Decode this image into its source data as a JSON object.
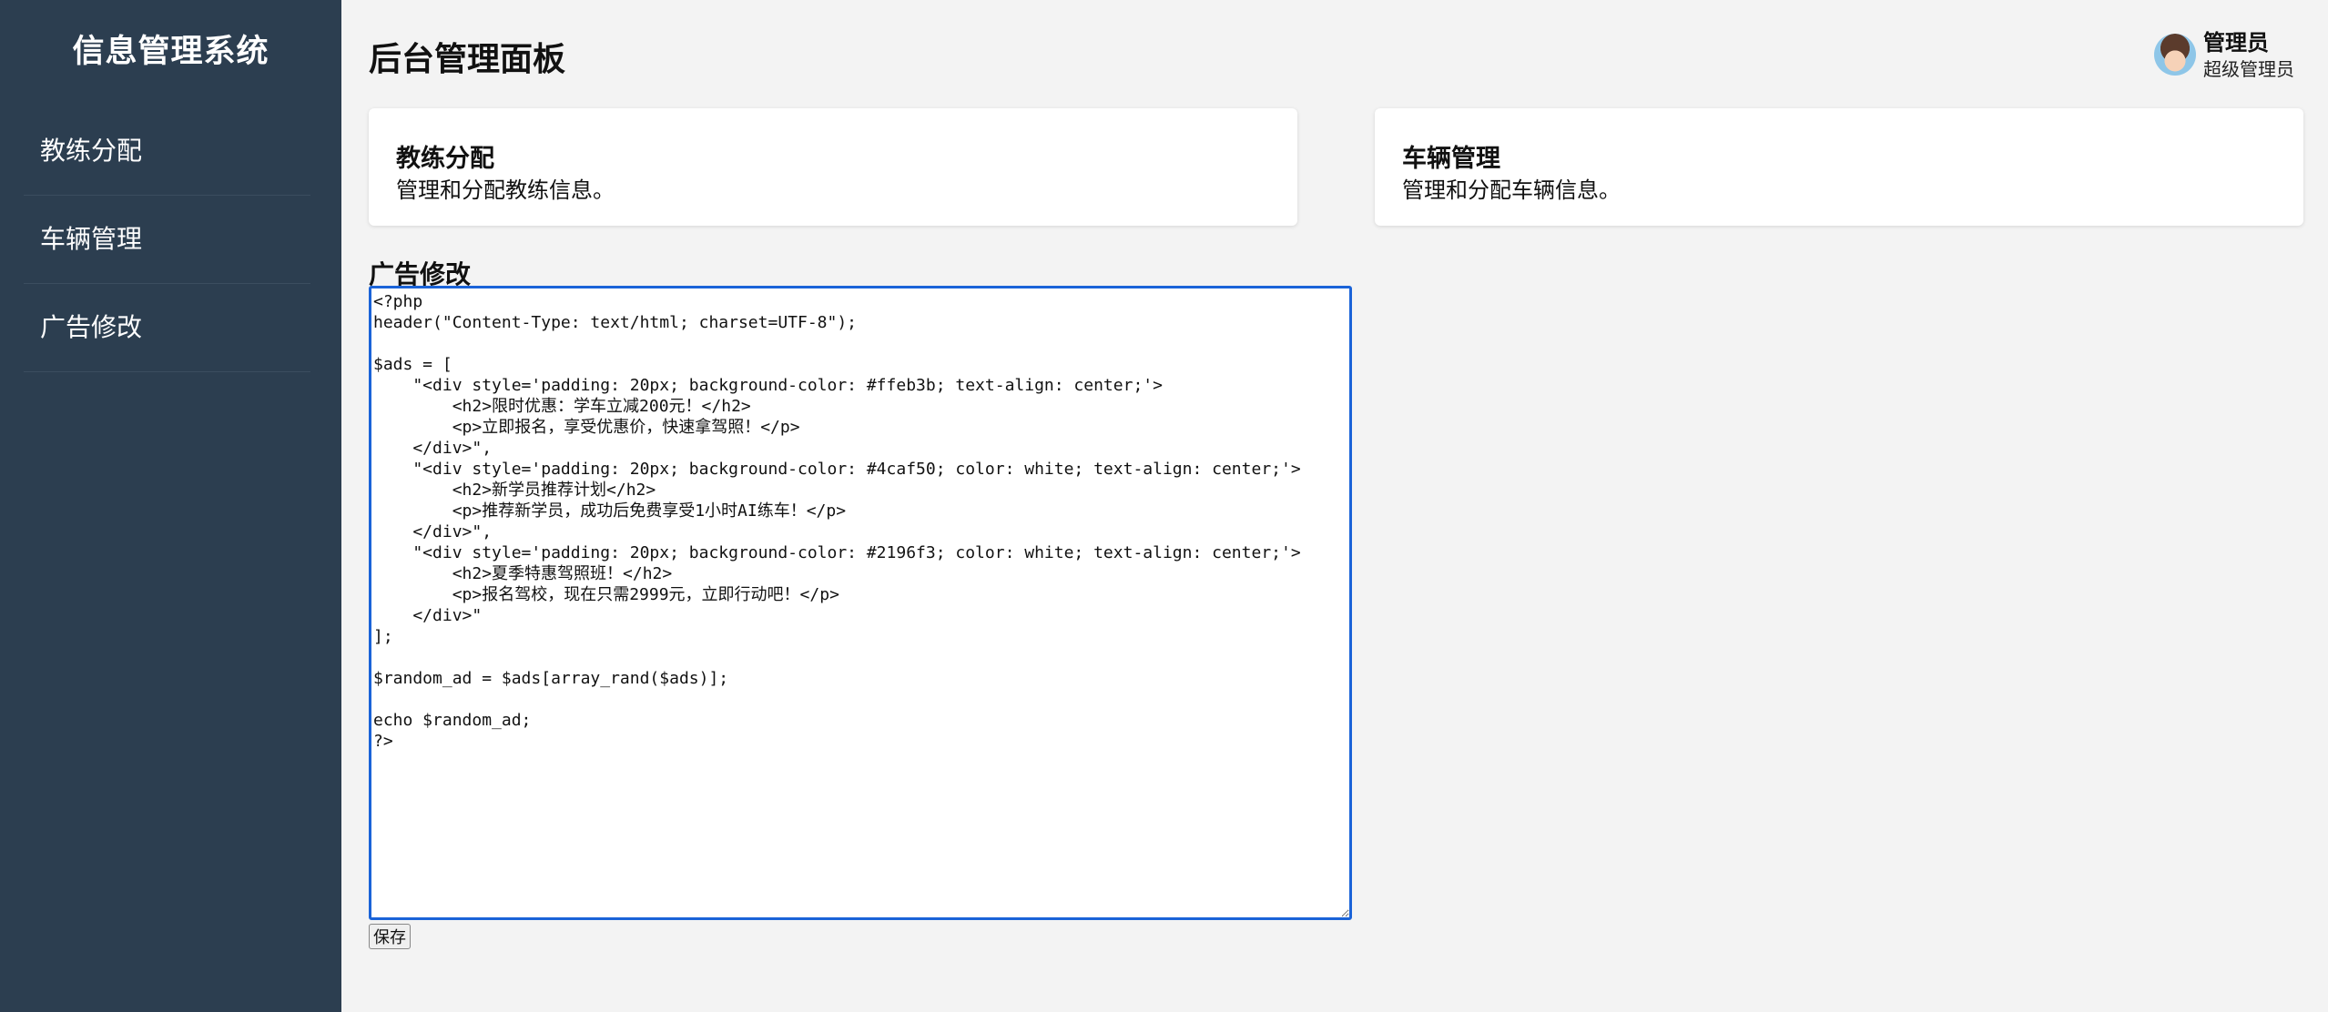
{
  "sidebar": {
    "brand": "信息管理系统",
    "items": [
      {
        "label": "教练分配"
      },
      {
        "label": "车辆管理"
      },
      {
        "label": "广告修改"
      }
    ]
  },
  "header": {
    "title": "后台管理面板",
    "user": {
      "name": "管理员",
      "role": "超级管理员"
    }
  },
  "cards": [
    {
      "title": "教练分配",
      "desc": "管理和分配教练信息。"
    },
    {
      "title": "车辆管理",
      "desc": "管理和分配车辆信息。"
    }
  ],
  "ad_editor": {
    "title": "广告修改",
    "code": "<?php\nheader(\"Content-Type: text/html; charset=UTF-8\");\n\n$ads = [\n    \"<div style='padding: 20px; background-color: #ffeb3b; text-align: center;'>\n        <h2>限时优惠：学车立减200元！</h2>\n        <p>立即报名，享受优惠价，快速拿驾照！</p>\n    </div>\",\n    \"<div style='padding: 20px; background-color: #4caf50; color: white; text-align: center;'>\n        <h2>新学员推荐计划</h2>\n        <p>推荐新学员，成功后免费享受1小时AI练车！</p>\n    </div>\",\n    \"<div style='padding: 20px; background-color: #2196f3; color: white; text-align: center;'>\n        <h2>夏季特惠驾照班！</h2>\n        <p>报名驾校，现在只需2999元，立即行动吧！</p>\n    </div>\"\n];\n\n$random_ad = $ads[array_rand($ads)];\n\necho $random_ad;\n?>",
    "save_label": "保存"
  },
  "colors": {
    "sidebar_bg": "#2c3e50",
    "page_bg": "#f3f3f3",
    "focus_border": "#1a63d8"
  }
}
